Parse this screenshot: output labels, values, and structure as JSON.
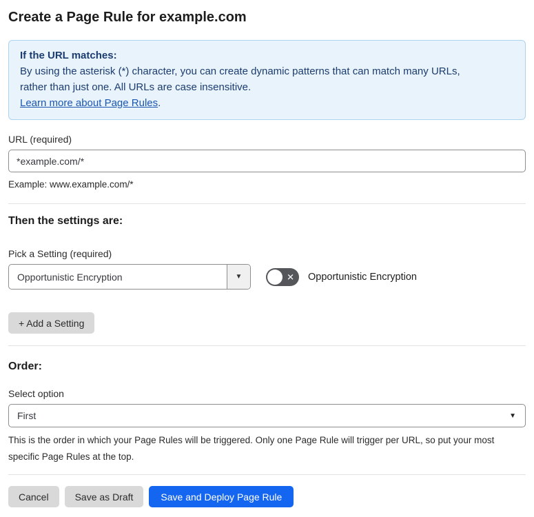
{
  "page": {
    "title": "Create a Page Rule for example.com"
  },
  "info_box": {
    "heading": "If the URL matches:",
    "body": "By using the asterisk (*) character, you can create dynamic patterns that can match many URLs, rather than just one. All URLs are case insensitive.",
    "link_label": "Learn more about Page Rules",
    "link_suffix": "."
  },
  "url_section": {
    "label": "URL (required)",
    "value": "*example.com/*",
    "helper": "Example: www.example.com/*"
  },
  "settings_section": {
    "heading": "Then the settings are:",
    "setting_label": "Pick a Setting (required)",
    "setting_value": "Opportunistic Encryption",
    "toggle_state": "off",
    "toggle_label": "Opportunistic Encryption",
    "add_button_label": "+ Add a Setting"
  },
  "order_section": {
    "heading": "Order:",
    "label": "Select option",
    "value": "First",
    "helper": "This is the order in which your Page Rules will be triggered. Only one Page Rule will trigger per URL, so put your most specific Page Rules at the top."
  },
  "footer": {
    "cancel_label": "Cancel",
    "save_draft_label": "Save as Draft",
    "save_deploy_label": "Save and Deploy Page Rule"
  },
  "icons": {
    "x": "✕",
    "caret_down": "▼"
  },
  "colors": {
    "accent_blue": "#1466f0",
    "info_bg": "#e9f3fc",
    "info_border": "#abd4f1",
    "info_text": "#1b3c6e",
    "link_blue": "#1a56b0",
    "toggle_track": "#54565a",
    "button_gray": "#d9d9d9"
  }
}
